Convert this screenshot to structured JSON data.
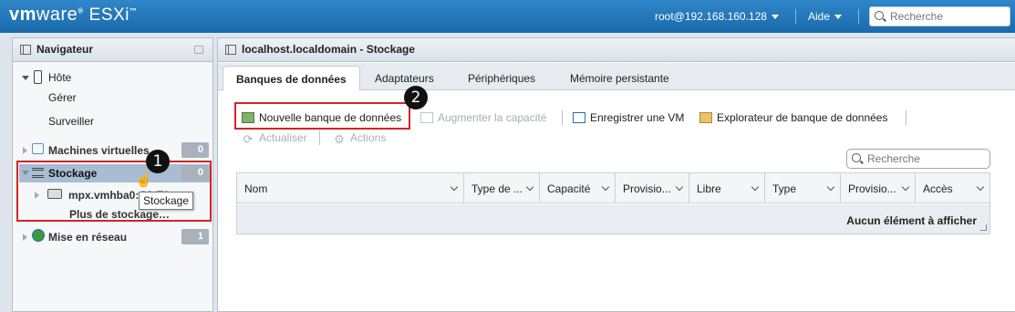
{
  "header": {
    "brand": "vm",
    "brand_suffix": "ware",
    "product": "ESXi",
    "user": "root@192.168.160.128",
    "help": "Aide",
    "search_placeholder": "Recherche"
  },
  "navigator": {
    "title": "Navigateur",
    "host": {
      "label": "Hôte",
      "children": [
        "Gérer",
        "Surveiller"
      ]
    },
    "vms": {
      "label": "Machines virtuelles",
      "count": "0"
    },
    "storage": {
      "label": "Stockage",
      "count": "0",
      "children": [
        "mpx.vmhba0:C0:T1:L0",
        "Plus de stockage…"
      ]
    },
    "network": {
      "label": "Mise en réseau",
      "count": "1"
    }
  },
  "main": {
    "title": "localhost.localdomain - Stockage",
    "tabs": [
      "Banques de données",
      "Adaptateurs",
      "Périphériques",
      "Mémoire persistante"
    ],
    "toolbar": {
      "new_datastore": "Nouvelle banque de données",
      "increase": "Augmenter la capacité",
      "register_vm": "Enregistrer une VM",
      "explorer": "Explorateur de banque de données",
      "refresh": "Actualiser",
      "actions": "Actions"
    },
    "search_placeholder": "Recherche",
    "columns": [
      "Nom",
      "Type de ...",
      "Capacité",
      "Provisio...",
      "Libre",
      "Type",
      "Provisio...",
      "Accès"
    ],
    "empty_message": "Aucun élément à afficher"
  },
  "tooltip": "Stockage",
  "steps": [
    "1",
    "2"
  ]
}
